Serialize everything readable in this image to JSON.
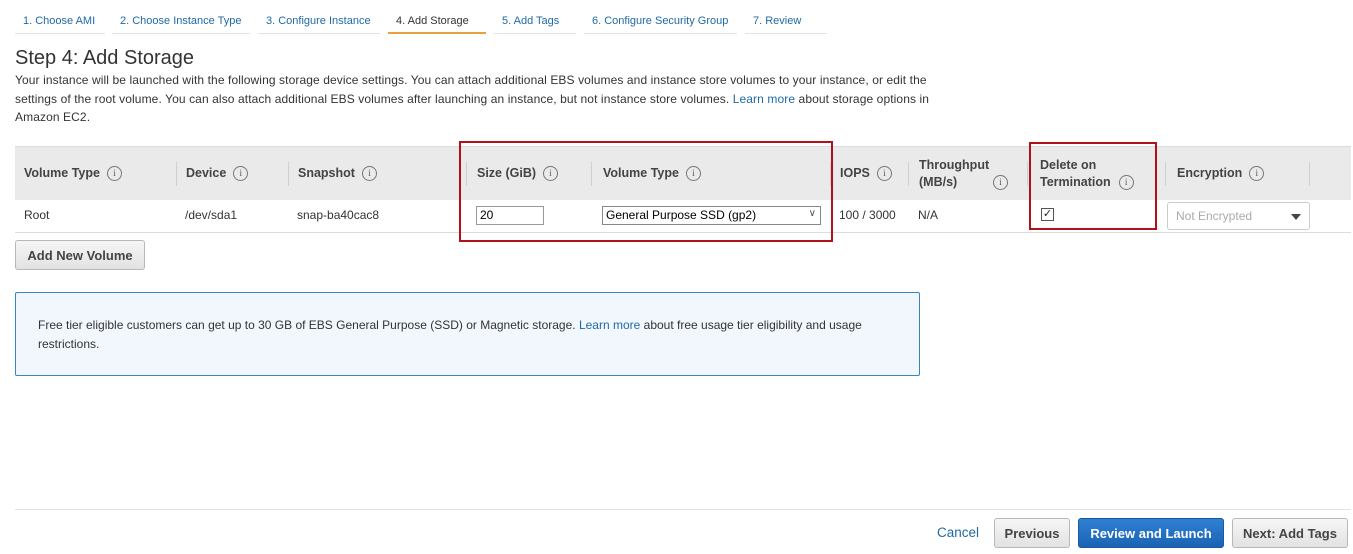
{
  "wizard_tabs": [
    {
      "label": "1. Choose AMI"
    },
    {
      "label": "2. Choose Instance Type"
    },
    {
      "label": "3. Configure Instance"
    },
    {
      "label": "4. Add Storage"
    },
    {
      "label": "5. Add Tags"
    },
    {
      "label": "6. Configure Security Group"
    },
    {
      "label": "7. Review"
    }
  ],
  "page": {
    "title": "Step 4: Add Storage",
    "description": "Your instance will be launched with the following storage device settings. You can attach additional EBS volumes and instance store volumes to your instance, or edit the settings of the root volume. You can also attach additional EBS volumes after launching an instance, but not instance store volumes.",
    "learn_more": "Learn more",
    "description_tail": "about storage options in Amazon EC2."
  },
  "table": {
    "headers": {
      "volume_type": "Volume Type",
      "device": "Device",
      "snapshot": "Snapshot",
      "size": "Size (GiB)",
      "volume_type_2": "Volume Type",
      "iops": "IOPS",
      "throughput_1": "Throughput",
      "throughput_2": "(MB/s)",
      "delete_1": "Delete on",
      "delete_2": "Termination",
      "encryption": "Encryption"
    },
    "info_glyph": "i",
    "row": {
      "volume_type": "Root",
      "device": "/dev/sda1",
      "snapshot": "snap-ba40cac8",
      "size": "20",
      "volume_type_select": "General Purpose SSD (gp2)",
      "iops": "100 / 3000",
      "throughput": "N/A",
      "delete_on_termination": true,
      "checkbox_glyph": "✓",
      "encryption": "Not Encrypted"
    }
  },
  "add_volume_button": "Add New Volume",
  "notice": {
    "text": "Free tier eligible customers can get up to 30 GB of EBS General Purpose (SSD) or Magnetic storage.",
    "learn_more": "Learn more",
    "text_tail": "about free usage tier eligibility and usage restrictions."
  },
  "footer": {
    "cancel": "Cancel",
    "previous": "Previous",
    "review_launch": "Review and Launch",
    "next": "Next: Add Tags"
  },
  "icons": {
    "info": "info-circle-icon",
    "select_chevron": "chevron-down-icon",
    "encryption_dropdown": "caret-down-icon"
  },
  "colors": {
    "link": "#1f6aa5",
    "active_tab_underline": "#e7a13f",
    "highlight_box": "#b0121b",
    "primary_button": "#1a63b3",
    "notice_border": "#3b84c4"
  }
}
